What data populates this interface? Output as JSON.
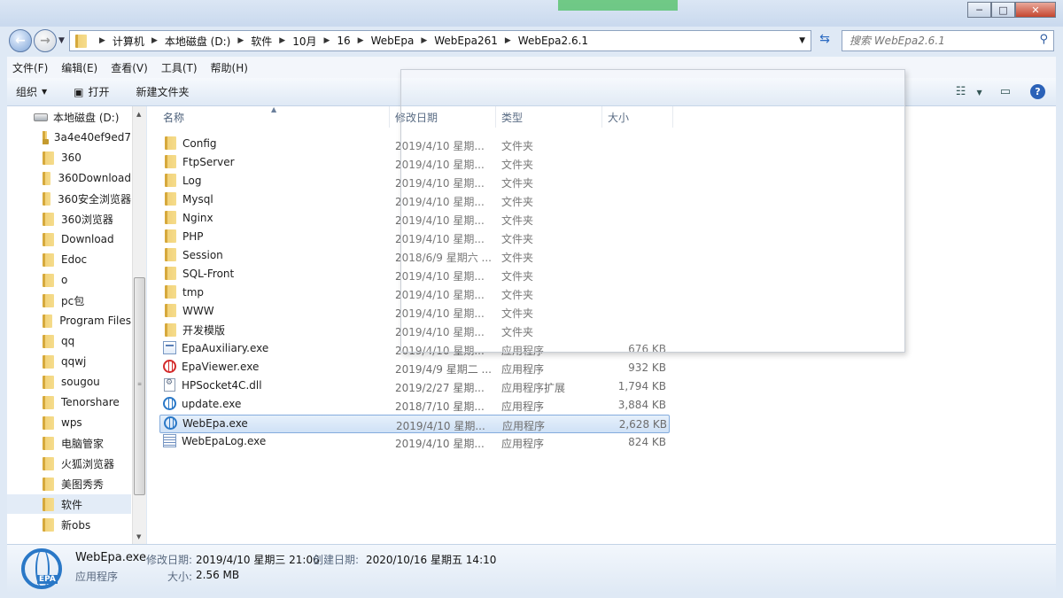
{
  "window": {
    "minimize": "─",
    "maximize": "□",
    "close": "✕"
  },
  "address": {
    "root_icon": "folder-icon",
    "crumbs": [
      "计算机",
      "本地磁盘 (D:)",
      "软件",
      "10月",
      "16",
      "WebEpa",
      "WebEpa261",
      "WebEpa2.6.1"
    ],
    "search_placeholder": "搜索 WebEpa2.6.1"
  },
  "menu": [
    "文件(F)",
    "编辑(E)",
    "查看(V)",
    "工具(T)",
    "帮助(H)"
  ],
  "toolbar": {
    "organize": "组织",
    "open": "打开",
    "new_folder": "新建文件夹"
  },
  "nav": [
    {
      "label": "本地磁盘 (D:)",
      "icon": "drive-icon"
    },
    {
      "label": "3a4e40ef9ed7",
      "icon": "locked-folder-icon"
    },
    {
      "label": "360",
      "icon": "folder-icon"
    },
    {
      "label": "360Download",
      "icon": "folder-icon"
    },
    {
      "label": "360安全浏览器",
      "icon": "folder-icon"
    },
    {
      "label": "360浏览器",
      "icon": "folder-icon"
    },
    {
      "label": "Download",
      "icon": "folder-icon"
    },
    {
      "label": "Edoc",
      "icon": "folder-icon"
    },
    {
      "label": "o",
      "icon": "folder-icon"
    },
    {
      "label": "pc包",
      "icon": "folder-icon"
    },
    {
      "label": "Program Files",
      "icon": "folder-icon"
    },
    {
      "label": "qq",
      "icon": "folder-icon"
    },
    {
      "label": "qqwj",
      "icon": "folder-icon"
    },
    {
      "label": "sougou",
      "icon": "folder-icon"
    },
    {
      "label": "Tenorshare",
      "icon": "folder-icon"
    },
    {
      "label": "wps",
      "icon": "folder-icon"
    },
    {
      "label": "电脑管家",
      "icon": "folder-icon"
    },
    {
      "label": "火狐浏览器",
      "icon": "folder-icon"
    },
    {
      "label": "美图秀秀",
      "icon": "folder-icon"
    },
    {
      "label": "软件",
      "icon": "folder-icon",
      "selected": true
    },
    {
      "label": "新obs",
      "icon": "folder-icon"
    }
  ],
  "columns": {
    "name": "名称",
    "date": "修改日期",
    "type": "类型",
    "size": "大小"
  },
  "files": [
    {
      "name": "Config",
      "date": "2019/4/10 星期...",
      "type": "文件夹",
      "size": "",
      "icon": "folder-icon"
    },
    {
      "name": "FtpServer",
      "date": "2019/4/10 星期...",
      "type": "文件夹",
      "size": "",
      "icon": "folder-icon"
    },
    {
      "name": "Log",
      "date": "2019/4/10 星期...",
      "type": "文件夹",
      "size": "",
      "icon": "folder-icon"
    },
    {
      "name": "Mysql",
      "date": "2019/4/10 星期...",
      "type": "文件夹",
      "size": "",
      "icon": "folder-icon"
    },
    {
      "name": "Nginx",
      "date": "2019/4/10 星期...",
      "type": "文件夹",
      "size": "",
      "icon": "folder-icon"
    },
    {
      "name": "PHP",
      "date": "2019/4/10 星期...",
      "type": "文件夹",
      "size": "",
      "icon": "folder-icon"
    },
    {
      "name": "Session",
      "date": "2018/6/9 星期六 ...",
      "type": "文件夹",
      "size": "",
      "icon": "folder-icon"
    },
    {
      "name": "SQL-Front",
      "date": "2019/4/10 星期...",
      "type": "文件夹",
      "size": "",
      "icon": "folder-icon"
    },
    {
      "name": "tmp",
      "date": "2019/4/10 星期...",
      "type": "文件夹",
      "size": "",
      "icon": "folder-icon"
    },
    {
      "name": "WWW",
      "date": "2019/4/10 星期...",
      "type": "文件夹",
      "size": "",
      "icon": "folder-icon"
    },
    {
      "name": "开发模版",
      "date": "2019/4/10 星期...",
      "type": "文件夹",
      "size": "",
      "icon": "folder-icon"
    },
    {
      "name": "EpaAuxiliary.exe",
      "date": "2019/4/10 星期...",
      "type": "应用程序",
      "size": "676 KB",
      "icon": "exe-icon"
    },
    {
      "name": "EpaViewer.exe",
      "date": "2019/4/9 星期二 ...",
      "type": "应用程序",
      "size": "932 KB",
      "icon": "red-globe-icon"
    },
    {
      "name": "HPSocket4C.dll",
      "date": "2019/2/27 星期...",
      "type": "应用程序扩展",
      "size": "1,794 KB",
      "icon": "dll-icon"
    },
    {
      "name": "update.exe",
      "date": "2018/7/10 星期...",
      "type": "应用程序",
      "size": "3,884 KB",
      "icon": "globe-icon"
    },
    {
      "name": "WebEpa.exe",
      "date": "2019/4/10 星期...",
      "type": "应用程序",
      "size": "2,628 KB",
      "icon": "globe-icon",
      "selected": true
    },
    {
      "name": "WebEpaLog.exe",
      "date": "2019/4/10 星期...",
      "type": "应用程序",
      "size": "824 KB",
      "icon": "log-icon"
    }
  ],
  "details": {
    "name": "WebEpa.exe",
    "modified_label": "修改日期:",
    "modified": "2019/4/10 星期三 21:06",
    "created_label": "创建日期:",
    "created": "2020/10/16 星期五 14:10",
    "type": "应用程序",
    "size_label": "大小:",
    "size": "2.56 MB",
    "icon_text": "EPA"
  }
}
